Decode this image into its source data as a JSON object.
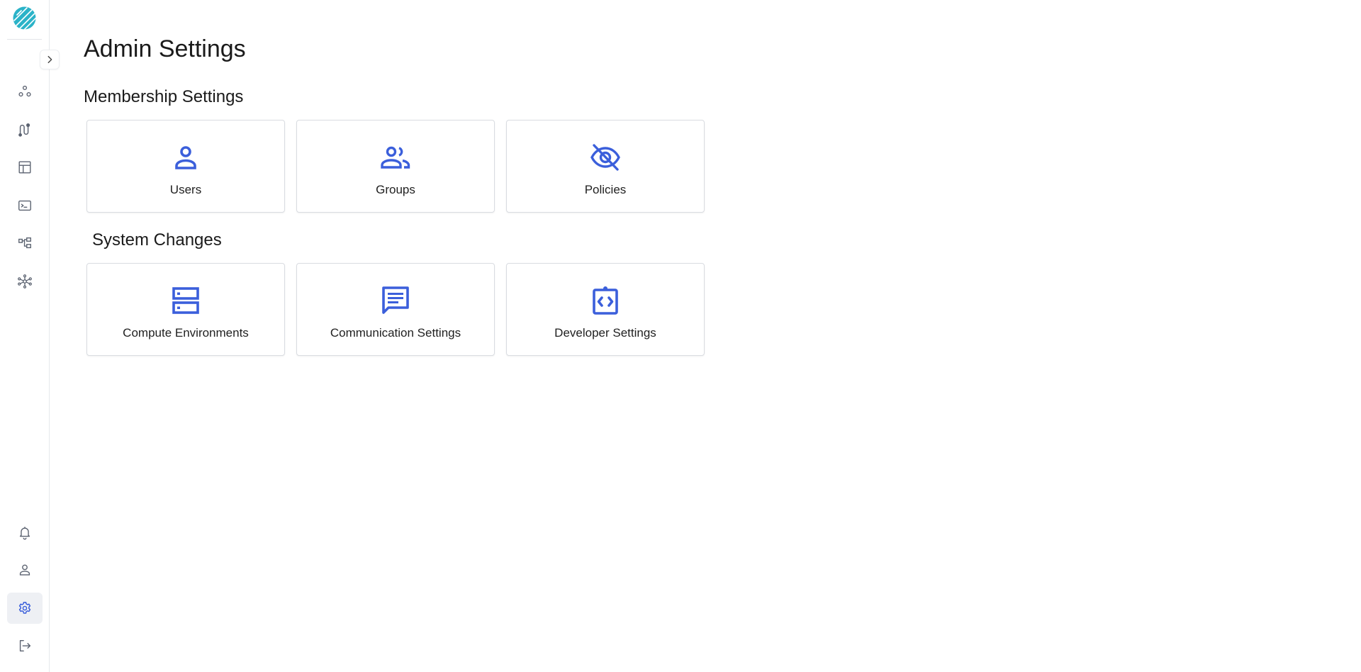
{
  "colors": {
    "accent": "#3b5fdb",
    "nav_icon": "#5b6270",
    "logo": "#2bb3c8"
  },
  "sidebar": {
    "logo": "app-logo",
    "expand_icon": "chevron-right-icon",
    "top_items": [
      {
        "icon": "projects-icon"
      },
      {
        "icon": "workflows-icon"
      },
      {
        "icon": "table-icon"
      },
      {
        "icon": "terminal-icon"
      },
      {
        "icon": "pipelines-icon"
      },
      {
        "icon": "network-icon"
      }
    ],
    "bottom_items": [
      {
        "icon": "bell-icon"
      },
      {
        "icon": "user-icon"
      },
      {
        "icon": "gear-icon",
        "active": true
      },
      {
        "icon": "logout-icon"
      }
    ]
  },
  "page": {
    "title": "Admin Settings",
    "sections": [
      {
        "title": "Membership Settings",
        "cards": [
          {
            "label": "Users",
            "icon": "user-icon"
          },
          {
            "label": "Groups",
            "icon": "groups-icon"
          },
          {
            "label": "Policies",
            "icon": "eye-off-icon"
          }
        ]
      },
      {
        "title": "System Changes",
        "cards": [
          {
            "label": "Compute Environments",
            "icon": "server-icon"
          },
          {
            "label": "Communication Settings",
            "icon": "chat-icon"
          },
          {
            "label": "Developer Settings",
            "icon": "code-clipboard-icon"
          }
        ]
      }
    ]
  }
}
